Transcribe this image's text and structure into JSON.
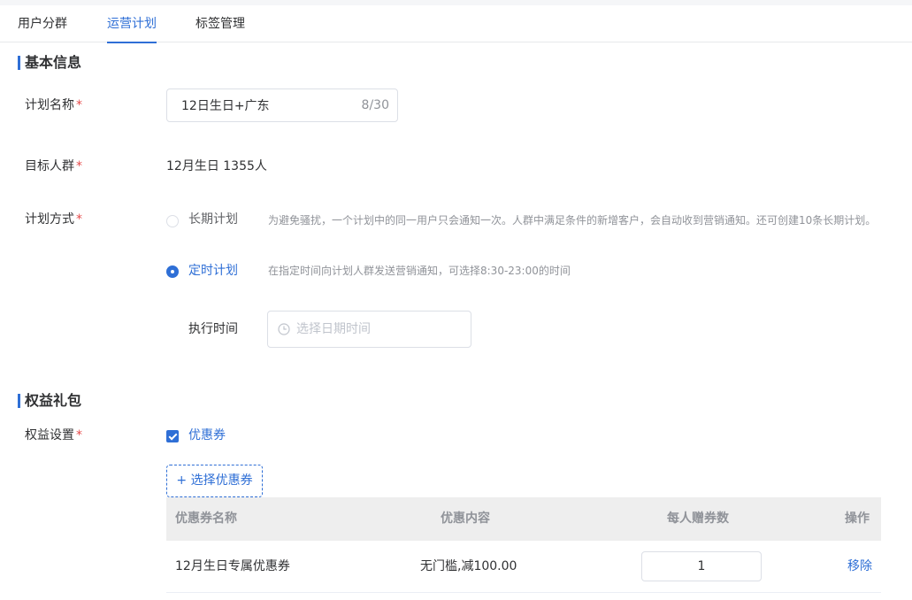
{
  "tabs": [
    {
      "label": "用户分群"
    },
    {
      "label": "运营计划"
    },
    {
      "label": "标签管理"
    }
  ],
  "basic_info": {
    "title": "基本信息",
    "plan_name_label": "计划名称",
    "plan_name_value": "12日生日+广东",
    "plan_name_count": "8/30",
    "target_label": "目标人群",
    "target_value": "12月生日 1355人",
    "mode_label": "计划方式",
    "required_mark": "*",
    "modes": [
      {
        "label": "长期计划",
        "hint": "为避免骚扰，一个计划中的同一用户只会通知一次。人群中满足条件的新增客户，会自动收到营销通知。还可创建10条长期计划。",
        "checked": false
      },
      {
        "label": "定时计划",
        "hint": "在指定时间向计划人群发送营销通知，可选择8:30-23:00的时间",
        "checked": true
      }
    ],
    "exec_time_label": "执行时间",
    "exec_time_placeholder": "选择日期时间"
  },
  "rights": {
    "title": "权益礼包",
    "setting_label": "权益设置",
    "coupon_checkbox_label": "优惠券",
    "coupon_checked": true,
    "select_coupon_button": "+ 选择优惠券",
    "table": {
      "headers": [
        "优惠券名称",
        "优惠内容",
        "每人赠券数",
        "操作"
      ],
      "rows": [
        {
          "name": "12月生日专属优惠券",
          "content": "无门槛,减100.00",
          "qty": "1",
          "action": "移除"
        }
      ]
    }
  },
  "colors": {
    "accent": "#2f6fd6",
    "required": "#e64b4b",
    "table_header_bg": "#eeeeee"
  }
}
